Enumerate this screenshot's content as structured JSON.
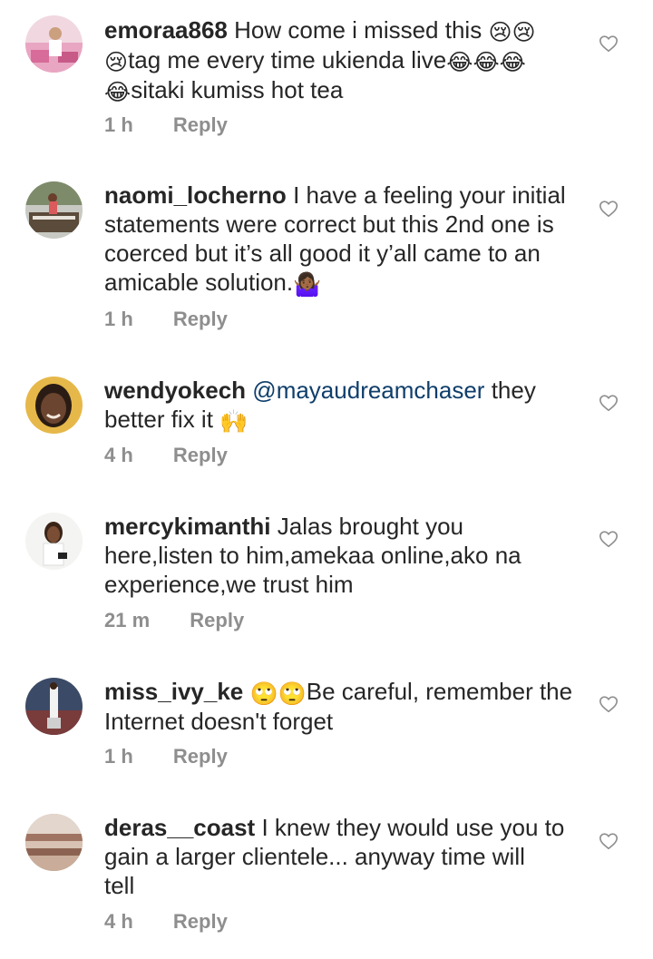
{
  "comments": [
    {
      "username": "emoraa868",
      "parts": [
        {
          "text": "How come i missed this "
        },
        {
          "emoji": "😢😢"
        },
        {
          "br": true
        },
        {
          "emoji": "😢"
        },
        {
          "text": "tag me every time ukienda live"
        },
        {
          "emoji": "😂😂😂"
        },
        {
          "br": true
        },
        {
          "emoji": "😂"
        },
        {
          "text": "sitaki kumiss hot tea"
        }
      ],
      "time": "1 h",
      "reply": "Reply"
    },
    {
      "username": "naomi_locherno",
      "parts": [
        {
          "text": "I have a feeling your initial"
        },
        {
          "br": true
        },
        {
          "text": "statements were correct but this 2nd one is"
        },
        {
          "br": true
        },
        {
          "text": "coerced but it’s all good it y’all came to an"
        },
        {
          "br": true
        },
        {
          "text": "amicable solution."
        },
        {
          "emoji": "🤷🏾‍♀️"
        }
      ],
      "time": "1 h",
      "reply": "Reply"
    },
    {
      "username": "wendyokech",
      "parts": [
        {
          "mention": "@mayaudreamchaser"
        },
        {
          "text": " they"
        },
        {
          "br": true
        },
        {
          "text": "better fix it "
        },
        {
          "emoji": "🙌"
        }
      ],
      "time": "4 h",
      "reply": "Reply"
    },
    {
      "username": "mercykimanthi",
      "parts": [
        {
          "text": "Jalas brought you"
        },
        {
          "br": true
        },
        {
          "text": "here,listen to him,amekaa online,ako na"
        },
        {
          "br": true
        },
        {
          "text": "experience,we trust him"
        }
      ],
      "time": "21 m",
      "reply": "Reply"
    },
    {
      "username": "miss_ivy_ke",
      "parts": [
        {
          "emoji": "🙄🙄"
        },
        {
          "text": "Be careful, remember the"
        },
        {
          "br": true
        },
        {
          "text": "Internet doesn't forget"
        }
      ],
      "time": "1 h",
      "reply": "Reply"
    },
    {
      "username": "deras__coast",
      "parts": [
        {
          "text": "I knew they would use you to"
        },
        {
          "br": true
        },
        {
          "text": "gain a larger clientele... anyway time will"
        },
        {
          "br": true
        },
        {
          "text": "tell"
        }
      ],
      "time": "4 h",
      "reply": "Reply"
    }
  ],
  "colors": {
    "text": "#262626",
    "meta": "#8e8e8e",
    "mention": "#0f3e6b",
    "like_outline": "#8e8e8e"
  },
  "icons": {
    "like": "heart-outline-icon"
  }
}
